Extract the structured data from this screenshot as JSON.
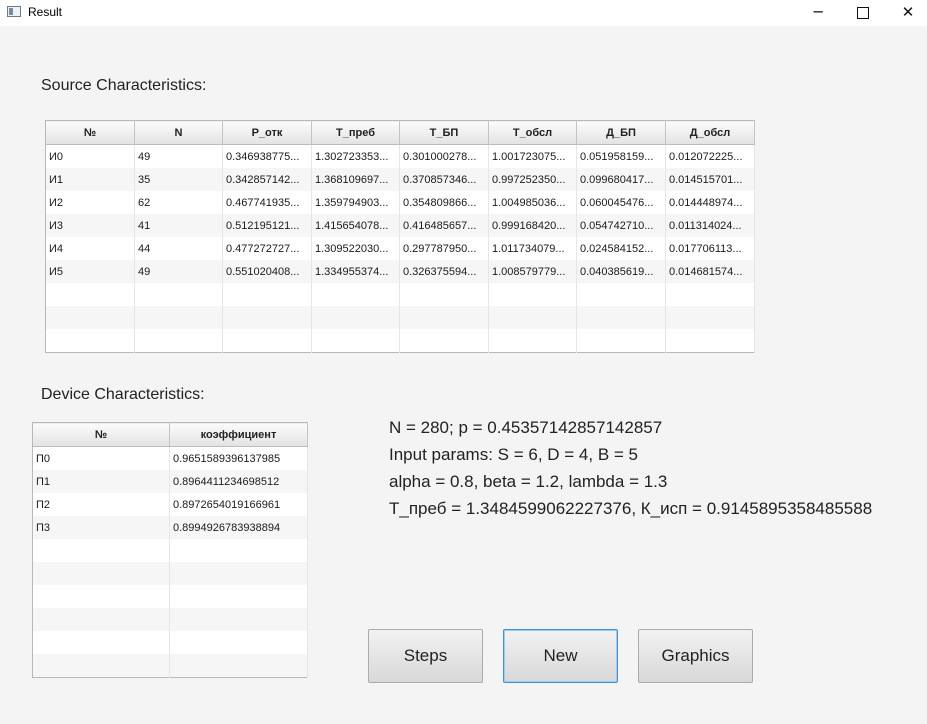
{
  "window": {
    "title": "Result",
    "minimize": "─",
    "close": "✕"
  },
  "source": {
    "label": "Source Characteristics:",
    "columns": [
      "№",
      "N",
      "P_отк",
      "T_преб",
      "T_БП",
      "T_обсл",
      "Д_БП",
      "Д_обсл"
    ],
    "rows": [
      [
        "И0",
        "49",
        "0.346938775...",
        "1.302723353...",
        "0.301000278...",
        "1.001723075...",
        "0.051958159...",
        "0.012072225..."
      ],
      [
        "И1",
        "35",
        "0.342857142...",
        "1.368109697...",
        "0.370857346...",
        "0.997252350...",
        "0.099680417...",
        "0.014515701..."
      ],
      [
        "И2",
        "62",
        "0.467741935...",
        "1.359794903...",
        "0.354809866...",
        "1.004985036...",
        "0.060045476...",
        "0.014448974..."
      ],
      [
        "И3",
        "41",
        "0.512195121...",
        "1.415654078...",
        "0.416485657...",
        "0.999168420...",
        "0.054742710...",
        "0.011314024..."
      ],
      [
        "И4",
        "44",
        "0.477272727...",
        "1.309522030...",
        "0.297787950...",
        "1.011734079...",
        "0.024584152...",
        "0.017706113..."
      ],
      [
        "И5",
        "49",
        "0.551020408...",
        "1.334955374...",
        "0.326375594...",
        "1.008579779...",
        "0.040385619...",
        "0.014681574..."
      ]
    ]
  },
  "device": {
    "label": "Device Characteristics:",
    "columns": [
      "№",
      "коэффициент"
    ],
    "rows": [
      [
        "П0",
        "0.9651589396137985"
      ],
      [
        "П1",
        "0.8964411234698512"
      ],
      [
        "П2",
        "0.8972654019166961"
      ],
      [
        "П3",
        "0.8994926783938894"
      ]
    ]
  },
  "info": {
    "line1": "N = 280; p = 0.45357142857142857",
    "line2": "Input params: S = 6, D = 4, B = 5",
    "line3": "alpha = 0.8, beta = 1.2, lambda = 1.3",
    "line4": "T_преб = 1.3484599062227376, К_исп = 0.9145895358485588"
  },
  "buttons": {
    "steps": "Steps",
    "new": "New",
    "graphics": "Graphics"
  }
}
